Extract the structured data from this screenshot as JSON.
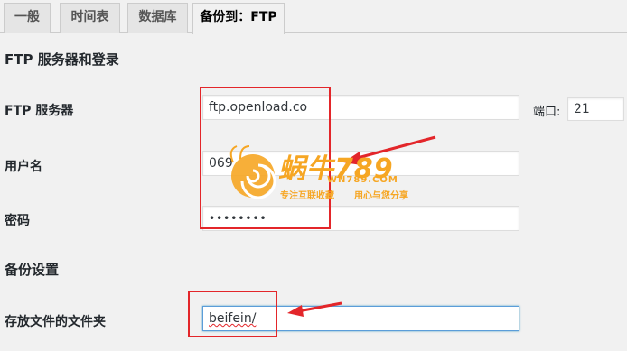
{
  "tabs": [
    {
      "label": "一般"
    },
    {
      "label": "时间表"
    },
    {
      "label": "数据库"
    },
    {
      "label": "备份到：FTP"
    }
  ],
  "ftp_section": {
    "title": "FTP 服务器和登录",
    "server_label": "FTP 服务器",
    "server_value": "ftp.openload.co",
    "port_label": "端口:",
    "port_value": "21",
    "username_label": "用户名",
    "username_value": "069",
    "password_label": "密码",
    "password_value": "••••••••"
  },
  "backup_section": {
    "title": "备份设置",
    "folder_label": "存放文件的文件夹",
    "folder_value": "beifein/"
  },
  "watermark": {
    "brand": "蜗牛789",
    "url": "WN789.COM",
    "slogan_left": "专注互联收藏",
    "slogan_right": "用心与您分享"
  },
  "annotation_color": "#e3262a"
}
